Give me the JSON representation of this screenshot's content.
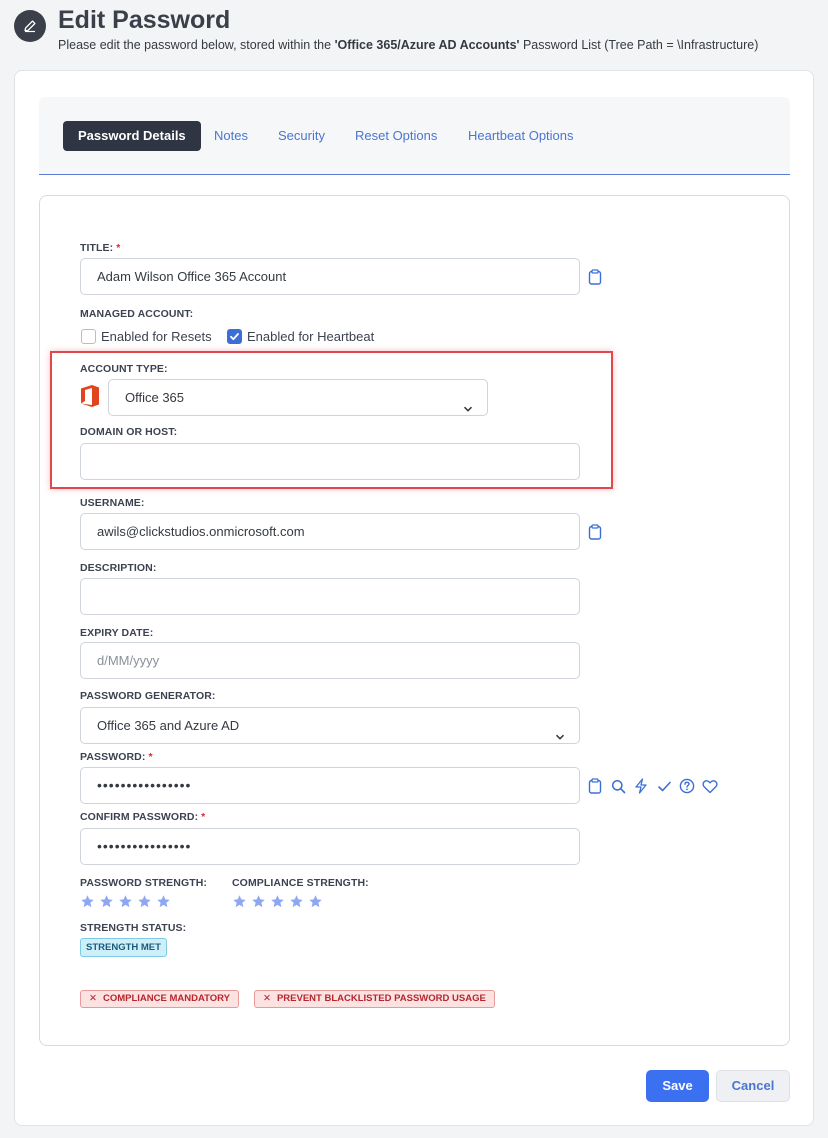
{
  "header": {
    "title": "Edit Password",
    "subtitle_pre": "Please edit the password below, stored within the ",
    "subtitle_list": "'Office 365/Azure AD Accounts'",
    "subtitle_post": " Password List (Tree Path = \\Infrastructure)"
  },
  "tabs": [
    {
      "label": "Password Details",
      "active": true
    },
    {
      "label": "Notes"
    },
    {
      "label": "Security"
    },
    {
      "label": "Reset Options"
    },
    {
      "label": "Heartbeat Options"
    }
  ],
  "form": {
    "title_label": "TITLE:",
    "title_value": "Adam Wilson Office 365 Account",
    "managed_label": "MANAGED ACCOUNT:",
    "resets_label": "Enabled for Resets",
    "resets_checked": false,
    "heartbeat_label": "Enabled for Heartbeat",
    "heartbeat_checked": true,
    "account_type_label": "ACCOUNT TYPE:",
    "account_type_value": "Office 365",
    "domain_label": "DOMAIN OR HOST:",
    "domain_value": "",
    "username_label": "USERNAME:",
    "username_value": "awils@clickstudios.onmicrosoft.com",
    "description_label": "DESCRIPTION:",
    "description_value": "",
    "expiry_label": "EXPIRY DATE:",
    "expiry_placeholder": "d/MM/yyyy",
    "generator_label": "PASSWORD GENERATOR:",
    "generator_value": "Office 365 and Azure AD",
    "password_label": "PASSWORD:",
    "password_value": "••••••••••••••••",
    "confirm_label": "CONFIRM PASSWORD:",
    "confirm_value": "••••••••••••••••",
    "required_mark": "*"
  },
  "strength": {
    "password_strength_label": "PASSWORD STRENGTH:",
    "compliance_strength_label": "COMPLIANCE STRENGTH:",
    "password_stars": 5,
    "compliance_stars": 5,
    "status_label": "STRENGTH STATUS:",
    "status_badge": "STRENGTH MET"
  },
  "policy_badges": [
    {
      "mark": "✕",
      "text": "COMPLIANCE MANDATORY"
    },
    {
      "mark": "✕",
      "text": "PREVENT BLACKLISTED PASSWORD USAGE"
    }
  ],
  "actions": {
    "save": "Save",
    "cancel": "Cancel"
  },
  "colors": {
    "accent": "#3b71f0",
    "star": "#8fa6f0",
    "highlight": "#e0484c",
    "office": "#e0451f"
  }
}
